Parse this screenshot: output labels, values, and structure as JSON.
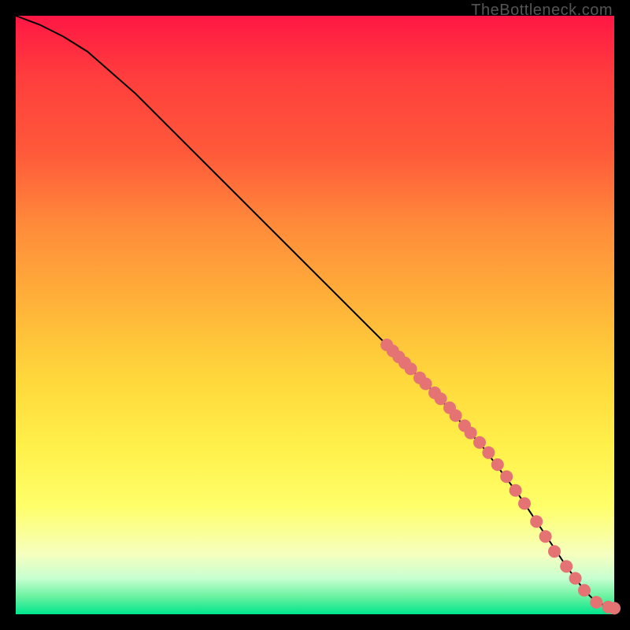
{
  "attribution": "TheBottleneck.com",
  "colors": {
    "gradient_top": "#ff1744",
    "gradient_mid": "#ffd63b",
    "gradient_bottom": "#00e58d",
    "dot": "#e57373",
    "curve": "#000000",
    "frame": "#000000"
  },
  "chart_data": {
    "type": "line",
    "title": "",
    "xlabel": "",
    "ylabel": "",
    "xlim": [
      0,
      100
    ],
    "ylim": [
      0,
      100
    ],
    "curve": {
      "x": [
        0,
        4,
        8,
        12,
        20,
        30,
        40,
        50,
        60,
        70,
        78,
        84,
        88,
        92,
        95,
        97,
        100
      ],
      "y": [
        100,
        98.5,
        96.5,
        94,
        87,
        77,
        67,
        57,
        47,
        37,
        28,
        20,
        14,
        8,
        4,
        2,
        1
      ]
    },
    "series": [
      {
        "name": "highlighted-segment",
        "points": [
          {
            "x": 62,
            "y": 45
          },
          {
            "x": 63,
            "y": 44
          },
          {
            "x": 64,
            "y": 43
          },
          {
            "x": 65,
            "y": 42
          },
          {
            "x": 66,
            "y": 41
          },
          {
            "x": 67.5,
            "y": 39.5
          },
          {
            "x": 68.5,
            "y": 38.5
          },
          {
            "x": 70,
            "y": 37
          },
          {
            "x": 71,
            "y": 36
          },
          {
            "x": 72.5,
            "y": 34.5
          },
          {
            "x": 73.5,
            "y": 33.2
          },
          {
            "x": 75,
            "y": 31.5
          },
          {
            "x": 76,
            "y": 30.3
          },
          {
            "x": 77.5,
            "y": 28.7
          },
          {
            "x": 79,
            "y": 27
          },
          {
            "x": 80.5,
            "y": 25
          },
          {
            "x": 82,
            "y": 23
          },
          {
            "x": 83.5,
            "y": 20.7
          },
          {
            "x": 85,
            "y": 18.5
          },
          {
            "x": 87,
            "y": 15.5
          },
          {
            "x": 88.5,
            "y": 13
          },
          {
            "x": 90,
            "y": 10.5
          },
          {
            "x": 92,
            "y": 8
          },
          {
            "x": 93.5,
            "y": 6
          },
          {
            "x": 95,
            "y": 4
          },
          {
            "x": 97,
            "y": 2
          },
          {
            "x": 99,
            "y": 1.2
          },
          {
            "x": 100,
            "y": 1
          }
        ]
      }
    ]
  }
}
